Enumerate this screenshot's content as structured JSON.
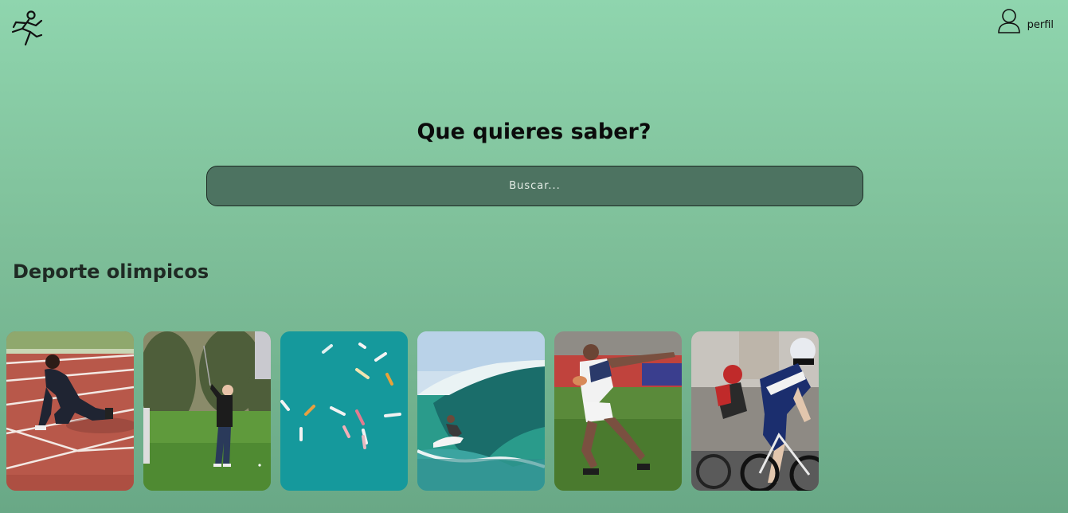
{
  "header": {
    "logo_icon": "running-person-icon",
    "profile_icon": "user-icon",
    "profile_label": "perfil"
  },
  "hero": {
    "title": "Que quieres saber?"
  },
  "search": {
    "placeholder": "Buscar..."
  },
  "olympics": {
    "title": "Deporte olimpicos",
    "cards": [
      {
        "sport": "atletismo",
        "image": "sprinter-on-track-photo"
      },
      {
        "sport": "golf",
        "image": "golfer-swing-photo"
      },
      {
        "sport": "surf-aerial",
        "image": "surfers-aerial-photo"
      },
      {
        "sport": "surf",
        "image": "surfer-wave-photo"
      },
      {
        "sport": "rugby",
        "image": "rugby-player-photo"
      },
      {
        "sport": "ciclismo",
        "image": "cyclists-race-photo"
      }
    ]
  },
  "colors": {
    "background_top": "#8fd5ae",
    "background_bottom": "#69a886",
    "search_fill": "#4d7361"
  }
}
